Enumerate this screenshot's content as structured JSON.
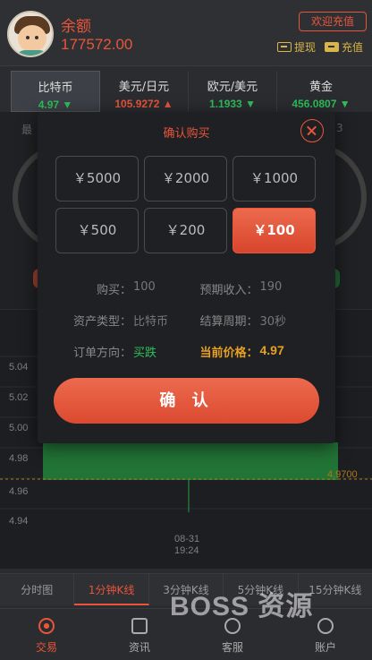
{
  "header": {
    "balance_label": "余额",
    "balance_value": "177572.00",
    "welcome_button": "欢迎充值",
    "withdraw_label": "提现",
    "recharge_label": "充值"
  },
  "tickers": [
    {
      "name": "比特币",
      "price": "4.97",
      "arrow": "▼",
      "trend": "down"
    },
    {
      "name": "美元/日元",
      "price": "105.9272",
      "arrow": "▲",
      "trend": "up"
    },
    {
      "name": "欧元/美元",
      "price": "1.1933",
      "arrow": "▼",
      "trend": "down"
    },
    {
      "name": "黄金",
      "price": "456.0807",
      "arrow": "▼",
      "trend": "down"
    }
  ],
  "background": {
    "left_label": "最",
    "right_label": "3"
  },
  "chart": {
    "y_ticks": [
      "5.04",
      "5.02",
      "5.00",
      "4.98",
      "4.96",
      "4.94"
    ],
    "current_price_label": "4.9700",
    "x_date": "08-31",
    "x_time": "19:24"
  },
  "chart_tabs": [
    "分时图",
    "1分钟K线",
    "3分钟K线",
    "5分钟K线",
    "15分钟K线"
  ],
  "nav": [
    "交易",
    "资讯",
    "客服",
    "账户"
  ],
  "watermark": "BOSS 资源",
  "modal": {
    "title": "确认购买",
    "amounts": [
      "￥5000",
      "￥2000",
      "￥1000",
      "￥500",
      "￥200",
      "￥100"
    ],
    "selected_amount_index": 5,
    "buy_label": "购买：",
    "buy_value": "100",
    "expected_label": "预期收入：",
    "expected_value": "190",
    "asset_type_label": "资产类型：",
    "asset_type_value": "比特币",
    "settle_label": "结算周期：",
    "settle_value": "30秒",
    "direction_label": "订单方向：",
    "direction_value": "买跌",
    "current_price_label": "当前价格：",
    "current_price_value": "4.97",
    "confirm_button": "确 认"
  },
  "colors": {
    "accent": "#e8553a",
    "up_green": "#2fbf5a",
    "gold": "#d8b44a",
    "price_orange": "#e8a020"
  }
}
